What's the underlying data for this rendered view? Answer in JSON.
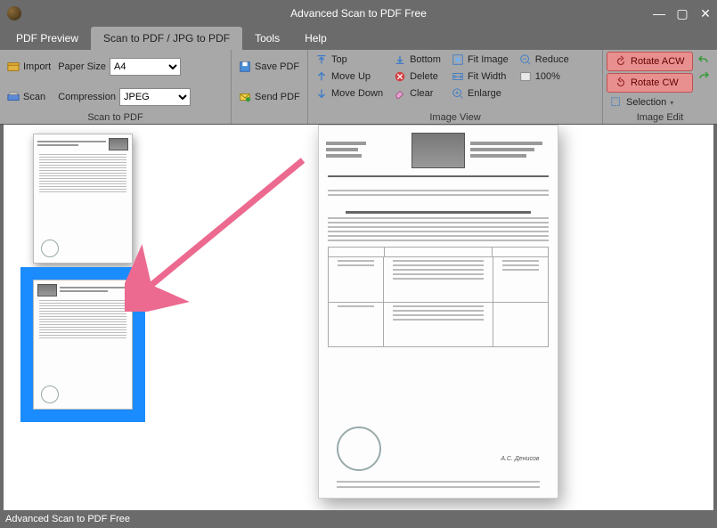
{
  "app": {
    "title": "Advanced Scan to PDF Free"
  },
  "window_buttons": {
    "min": "—",
    "max": "▢",
    "close": "✕"
  },
  "menu": {
    "tabs": [
      {
        "label": "PDF Preview"
      },
      {
        "label": "Scan to PDF / JPG to PDF",
        "active": true
      },
      {
        "label": "Tools"
      },
      {
        "label": "Help"
      }
    ]
  },
  "ribbon": {
    "groups": {
      "scan_to_pdf": {
        "label": "Scan to PDF",
        "import": "Import",
        "scan": "Scan",
        "paper_size_label": "Paper Size",
        "paper_size_value": "A4",
        "compression_label": "Compression",
        "compression_value": "JPEG",
        "save_pdf": "Save PDF",
        "send_pdf": "Send PDF"
      },
      "image_view": {
        "label": "Image View",
        "top": "Top",
        "move_up": "Move Up",
        "move_down": "Move Down",
        "bottom": "Bottom",
        "delete": "Delete",
        "clear": "Clear",
        "fit_image": "Fit Image",
        "fit_width": "Fit Width",
        "enlarge": "Enlarge",
        "reduce": "Reduce",
        "zoom_100": "100%"
      },
      "image_edit": {
        "label": "Image Edit",
        "rotate_acw": "Rotate ACW",
        "rotate_cw": "Rotate CW",
        "selection": "Selection"
      }
    }
  },
  "statusbar": {
    "text": "Advanced Scan to PDF Free"
  }
}
